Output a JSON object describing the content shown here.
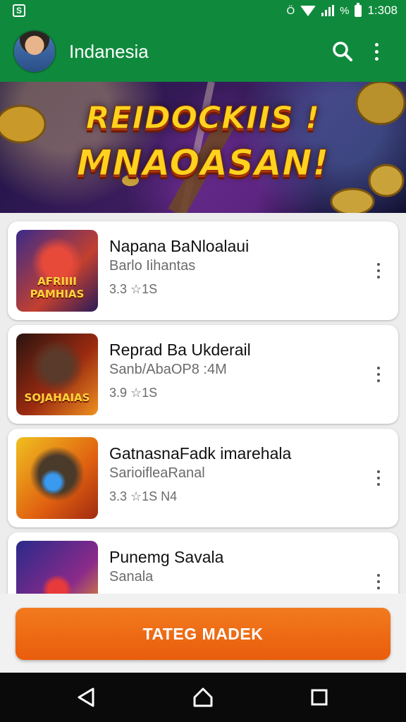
{
  "status_bar": {
    "time": "1:308",
    "app_glyph": "S",
    "battery_text": "%",
    "nfc_glyph": "Ö",
    "icons": [
      "nfc-icon",
      "wifi-icon",
      "signal-icon",
      "battery-icon"
    ]
  },
  "app_bar": {
    "title": "Indanesia",
    "icons": [
      "avatar",
      "search-icon",
      "more-vertical-icon"
    ]
  },
  "banner": {
    "line1": "REIDOCKIIS !",
    "line2": "MNAOASAN!"
  },
  "games": [
    {
      "title": "Napana BaNloalaui",
      "subtitle": "Barlo Iihantas",
      "meta": "3.3 ☆1S",
      "thumb_text": "AFRIIII PAMHIAS"
    },
    {
      "title": "Reprad Ba Ukderail",
      "subtitle": "Sanb/AbaOP8 :4M",
      "meta": "3.9 ☆1S",
      "thumb_text": "SOJAHAIAS"
    },
    {
      "title": "GatnasnaFadk imarehala",
      "subtitle": "SarioifleaRanal",
      "meta": "3.3 ☆1S N4",
      "thumb_text": ""
    },
    {
      "title": "Punemg Savala",
      "subtitle": "Sanala",
      "meta": "",
      "thumb_text": ""
    }
  ],
  "cta": {
    "label": "TATEG MADEK"
  },
  "nav": {
    "icons": [
      "back-icon",
      "home-icon",
      "recents-icon"
    ]
  },
  "colors": {
    "primary": "#0f8a3c",
    "cta": "#ef6c16",
    "card_bg": "#ffffff"
  }
}
